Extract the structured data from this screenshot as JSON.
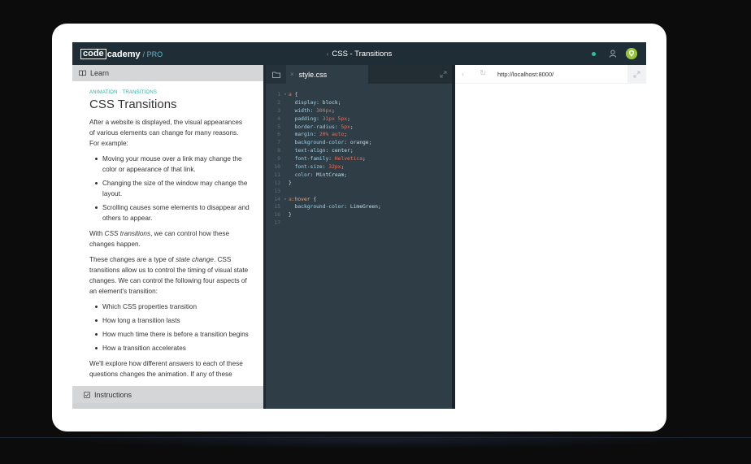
{
  "topbar": {
    "logo_box": "code",
    "logo_rest": "cademy",
    "logo_pro": "/ PRO",
    "title_chevron": "‹",
    "title": "CSS - Transitions"
  },
  "learn": {
    "header_label": "Learn",
    "kicker": "ANIMATION · TRANSITIONS",
    "title": "CSS Transitions",
    "intro": "After a website is displayed, the visual appearances of various elements can change for many reasons. For example:",
    "reasons": [
      "Moving your mouse over a link may change the color or appearance of that link.",
      "Changing the size of the window may change the layout.",
      "Scrolling causes some elements to disappear and others to appear."
    ],
    "p2_before": "With ",
    "p2_em": "CSS transitions",
    "p2_after": ", we can control how these changes happen.",
    "p3_before": "These changes are a type of ",
    "p3_em": "state change",
    "p3_after": ". CSS transitions allow us to control the timing of visual state changes. We can control the following four aspects of an element's transition:",
    "aspects": [
      "Which CSS properties transition",
      "How long a transition lasts",
      "How much time there is before a transition begins",
      "How a transition accelerates"
    ],
    "p4": "We'll explore how different answers to each of these questions changes the animation. If any of these",
    "instructions_label": "Instructions"
  },
  "editor": {
    "tab_close": "×",
    "tab_label": "style.css",
    "lines": [
      {
        "n": "1",
        "fold": "▾",
        "tokens": [
          {
            "c": "sel",
            "t": "a"
          },
          {
            "c": "brace",
            "t": " {"
          }
        ]
      },
      {
        "n": "2",
        "fold": "",
        "tokens": [
          {
            "c": "prop",
            "t": "  display"
          },
          {
            "c": "brace",
            "t": ": "
          },
          {
            "c": "kw",
            "t": "block"
          },
          {
            "c": "brace",
            "t": ";"
          }
        ]
      },
      {
        "n": "3",
        "fold": "",
        "tokens": [
          {
            "c": "prop",
            "t": "  width"
          },
          {
            "c": "brace",
            "t": ": "
          },
          {
            "c": "val",
            "t": "300px"
          },
          {
            "c": "brace",
            "t": ";"
          }
        ]
      },
      {
        "n": "4",
        "fold": "",
        "tokens": [
          {
            "c": "prop",
            "t": "  padding"
          },
          {
            "c": "brace",
            "t": ": "
          },
          {
            "c": "val",
            "t": "31px 5px"
          },
          {
            "c": "brace",
            "t": ";"
          }
        ]
      },
      {
        "n": "5",
        "fold": "",
        "tokens": [
          {
            "c": "prop",
            "t": "  border-radius"
          },
          {
            "c": "brace",
            "t": ": "
          },
          {
            "c": "val",
            "t": "5px"
          },
          {
            "c": "brace",
            "t": ";"
          }
        ]
      },
      {
        "n": "6",
        "fold": "",
        "tokens": [
          {
            "c": "prop",
            "t": "  margin"
          },
          {
            "c": "brace",
            "t": ": "
          },
          {
            "c": "val",
            "t": "20% auto"
          },
          {
            "c": "brace",
            "t": ";"
          }
        ]
      },
      {
        "n": "7",
        "fold": "",
        "tokens": [
          {
            "c": "prop",
            "t": "  background-color"
          },
          {
            "c": "brace",
            "t": ": "
          },
          {
            "c": "kw",
            "t": "orange"
          },
          {
            "c": "brace",
            "t": ";"
          }
        ]
      },
      {
        "n": "8",
        "fold": "",
        "tokens": [
          {
            "c": "prop",
            "t": "  text-align"
          },
          {
            "c": "brace",
            "t": ": "
          },
          {
            "c": "kw",
            "t": "center"
          },
          {
            "c": "brace",
            "t": ";"
          }
        ]
      },
      {
        "n": "9",
        "fold": "",
        "tokens": [
          {
            "c": "prop",
            "t": "  font-family"
          },
          {
            "c": "brace",
            "t": ": "
          },
          {
            "c": "val",
            "t": "Helvetica"
          },
          {
            "c": "brace",
            "t": ";"
          }
        ]
      },
      {
        "n": "10",
        "fold": "",
        "tokens": [
          {
            "c": "prop",
            "t": "  font-size"
          },
          {
            "c": "brace",
            "t": ": "
          },
          {
            "c": "val",
            "t": "32px"
          },
          {
            "c": "brace",
            "t": ";"
          }
        ]
      },
      {
        "n": "11",
        "fold": "",
        "tokens": [
          {
            "c": "prop",
            "t": "  color"
          },
          {
            "c": "brace",
            "t": ": "
          },
          {
            "c": "kw",
            "t": "MintCream"
          },
          {
            "c": "brace",
            "t": ";"
          }
        ]
      },
      {
        "n": "12",
        "fold": "",
        "tokens": [
          {
            "c": "brace",
            "t": "}"
          }
        ]
      },
      {
        "n": "13",
        "fold": "",
        "tokens": []
      },
      {
        "n": "14",
        "fold": "▾",
        "tokens": [
          {
            "c": "sel",
            "t": "a"
          },
          {
            "c": "pseudo",
            "t": ":hover"
          },
          {
            "c": "brace",
            "t": " {"
          }
        ]
      },
      {
        "n": "15",
        "fold": "",
        "tokens": [
          {
            "c": "prop",
            "t": "  background-color"
          },
          {
            "c": "brace",
            "t": ": "
          },
          {
            "c": "kw",
            "t": "LimeGreen"
          },
          {
            "c": "brace",
            "t": ";"
          }
        ]
      },
      {
        "n": "16",
        "fold": "",
        "tokens": [
          {
            "c": "brace",
            "t": "}"
          }
        ]
      },
      {
        "n": "17",
        "fold": "",
        "tokens": []
      }
    ]
  },
  "browser": {
    "back_glyph": "‹",
    "reload_glyph": "↻",
    "url": "http://localhost:8000/"
  },
  "icons": {
    "learn": "book-icon",
    "instructions": "checkbox-icon",
    "folder": "folder-icon",
    "expand": "expand-icon",
    "person": "person-icon",
    "avatar": "avatar-icon"
  },
  "colors": {
    "accent": "#2bb3a6",
    "status": "#2fbf9e",
    "avatar": "#97c33b",
    "topbar": "#1f2d37",
    "editor": "#2f3d47"
  }
}
